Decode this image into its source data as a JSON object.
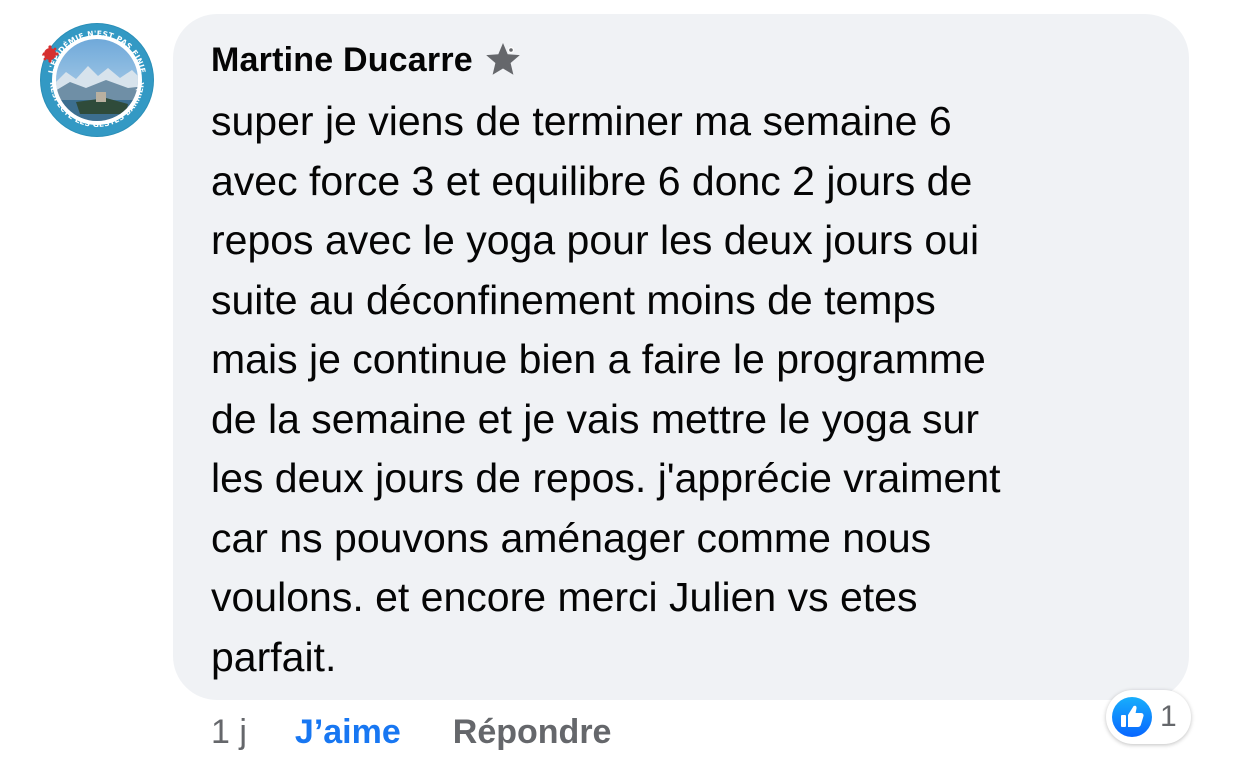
{
  "comment": {
    "author": "Martine Ducarre",
    "author_badge_icon": "star-badge-icon",
    "avatar": {
      "ring_text_top": "L'ÉPIDÉMIE N'EST PAS FINIE",
      "ring_text_bottom": "JE RESPECTE LES GESTES BARRIÈRES"
    },
    "text": "super je viens de terminer ma semaine 6\navec force 3 et equilibre 6 donc 2 jours de\nrepos avec le yoga pour les deux jours oui\nsuite au déconfinement moins de temps\nmais je continue bien a faire le programme\nde la semaine et je vais mettre le yoga sur\nles deux jours de repos. j'apprécie vraiment\ncar ns pouvons aménager comme nous\nvoulons. et encore merci Julien vs etes\nparfait."
  },
  "actions": {
    "time": "1 j",
    "like_label": "J’aime",
    "reply_label": "Répondre"
  },
  "reactions": {
    "icon": "thumbs-up-icon",
    "count": "1"
  },
  "colors": {
    "bubble": "#f0f2f5",
    "like_blue": "#1877f2",
    "secondary_text": "#65676b"
  }
}
